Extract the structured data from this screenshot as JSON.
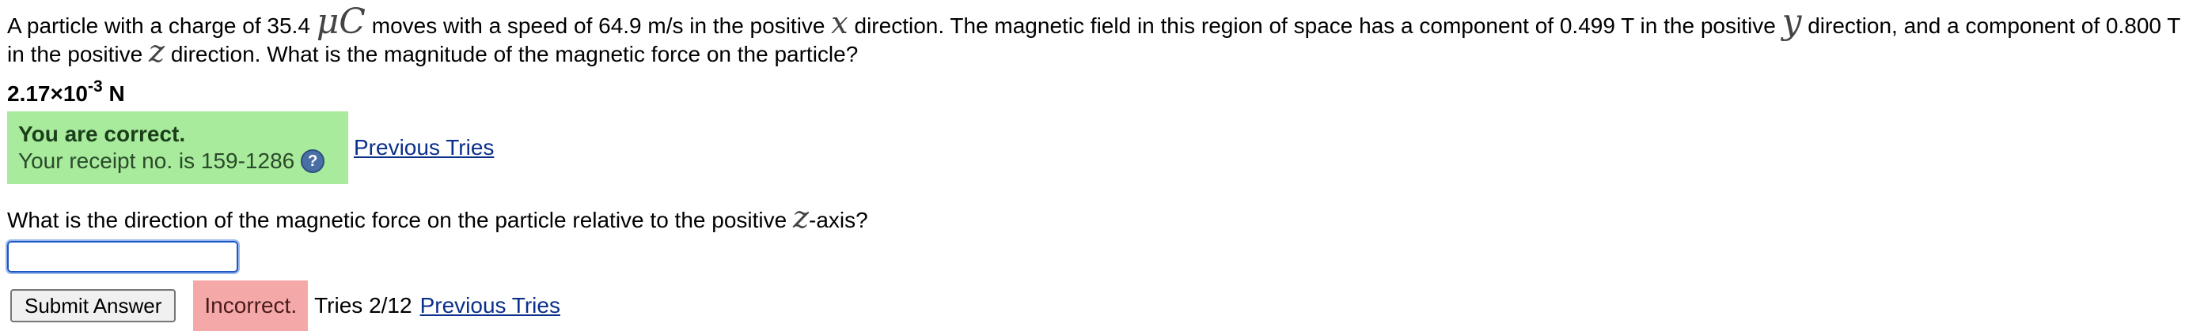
{
  "question1": {
    "part1": "A particle with a charge of 35.4",
    "unit_mu": "μ",
    "unit_c": "C",
    "part2": "moves with a speed of 64.9 m/s in the positive",
    "var_x": "x",
    "part3": "direction. The magnetic field in this region of space has a component of 0.499 T in the positive",
    "var_y": "y",
    "part4": "direction, and a component of 0.800 T in the positive",
    "var_z": "z",
    "part5": "direction. What is the magnitude of the magnetic force on the particle?"
  },
  "answer1": {
    "mantissa": "2.17×10",
    "exponent": "-3",
    "unit": "N"
  },
  "feedback1": {
    "title": "You are correct.",
    "receipt": "Your receipt no. is 159-1286",
    "help_icon": "?",
    "previous_tries": "Previous Tries"
  },
  "question2": {
    "part1": "What is the direction of the magnetic force on the particle relative to the positive",
    "var_z": "z",
    "part2": "-axis?"
  },
  "answer2": {
    "value": "",
    "submit_label": "Submit Answer",
    "status": "Incorrect.",
    "tries": "Tries 2/12",
    "previous_tries": "Previous Tries"
  },
  "colors": {
    "correct_bg": "#a8eb9c",
    "incorrect_bg": "#f4a9a8",
    "link": "#0b2f8a"
  }
}
